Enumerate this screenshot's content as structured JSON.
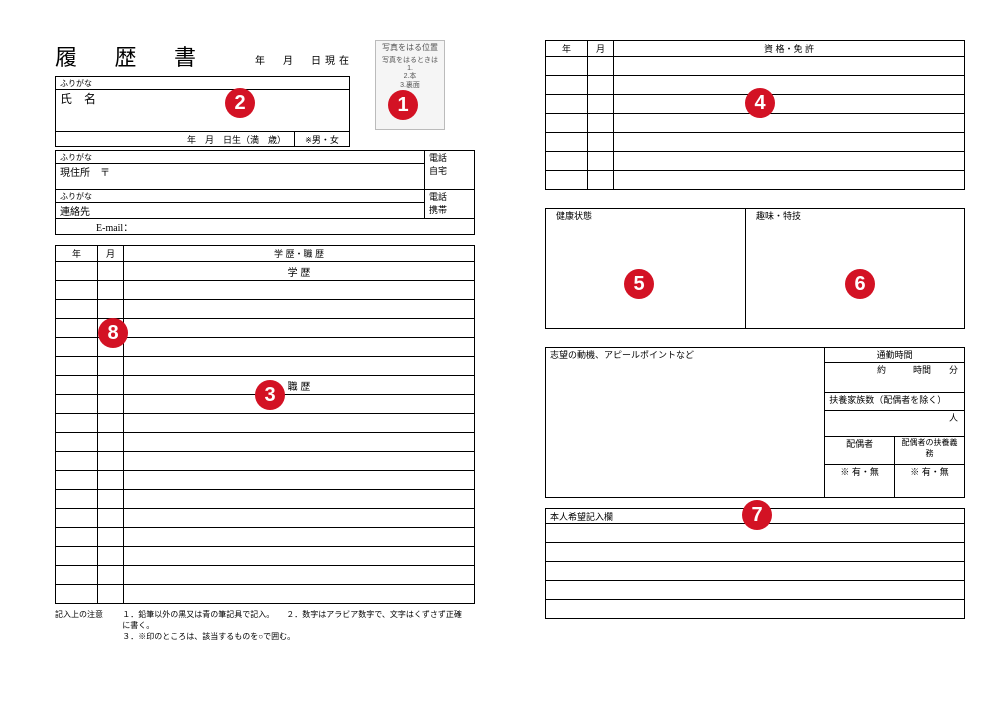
{
  "title": "履 歴 書",
  "date_line": "年　月　日現在",
  "photo": {
    "caption": "写真をはる位置",
    "note": "写真をはるときは\n1.\n2.本\n3.裏面"
  },
  "name_block": {
    "furigana_label": "ふりがな",
    "name_label": "氏　名",
    "birth_line": "年　月　日生（満　歳）",
    "gender_mark": "※",
    "gender_options": "男・女"
  },
  "address_block": {
    "furigana_label": "ふりがな",
    "current_address": "現住所　〒",
    "contact_label": "連絡先",
    "phone_label": "電話",
    "home_label": "自宅",
    "mobile_label": "携帯",
    "email_label": "E-mail："
  },
  "history_block": {
    "col_year": "年",
    "col_month": "月",
    "col_detail": "学 歴・職 歴",
    "heading_edu": "学 歴",
    "heading_work": "職 歴"
  },
  "notes": {
    "label": "記入上の注意",
    "line1": "１．鉛筆以外の黒又は青の筆記具で記入。　　２．数字はアラビア数字で、文字はくずさず正確に書く。",
    "line2": "３．※印のところは、該当するものを○で囲む。"
  },
  "qual_block": {
    "col_year": "年",
    "col_month": "月",
    "col_detail": "資 格・免 許"
  },
  "health_block": {
    "health_label": "健康状態",
    "hobby_label": "趣味・特技"
  },
  "motives_block": {
    "motive_label": "志望の動機、アピールポイントなど",
    "commute_label": "通勤時間",
    "commute_value": "約　　　時間　　分",
    "dependents_label": "扶養家族数（配偶者を除く）",
    "dependents_unit": "人",
    "spouse_label": "配偶者",
    "spouse_duty_label": "配偶者の扶養義務",
    "spouse_choice": "※ 有・無"
  },
  "wish_block": {
    "label": "本人希望記入欄"
  },
  "markers": {
    "m1": "1",
    "m2": "2",
    "m3": "3",
    "m4": "4",
    "m5": "5",
    "m6": "6",
    "m7": "7",
    "m8": "8"
  }
}
